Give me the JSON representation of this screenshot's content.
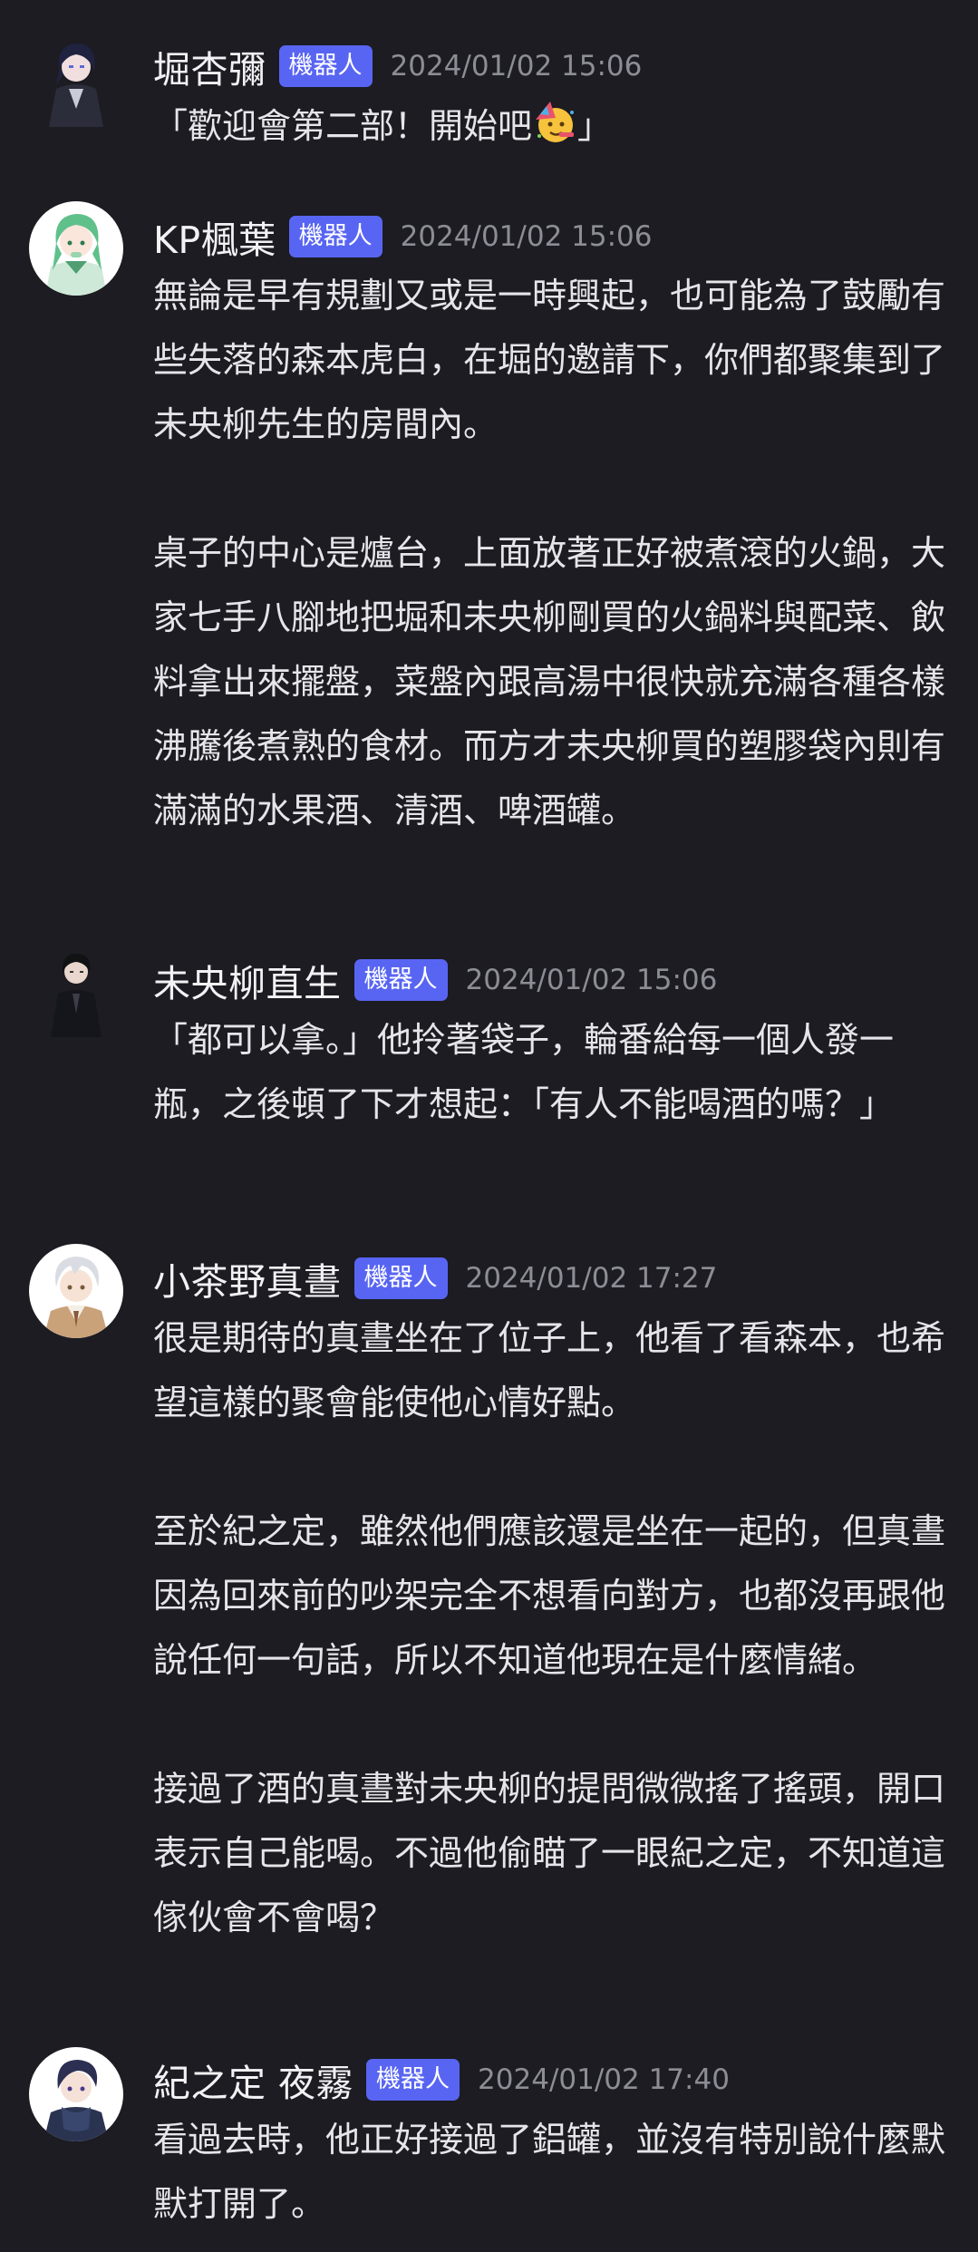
{
  "messages": [
    {
      "author": "堀杏彌",
      "badge": "機器人",
      "timestamp": "2024/01/02 15:06",
      "avatar_icon": "avatar-hori",
      "paragraphs": [
        "「歡迎會第二部！開始吧",
        "」"
      ],
      "inline_emoji": "partying-face"
    },
    {
      "author": "KP楓葉",
      "badge": "機器人",
      "timestamp": "2024/01/02 15:06",
      "avatar_icon": "avatar-kp-maple",
      "paragraphs": [
        "無論是早有規劃又或是一時興起，也可能為了鼓勵有些失落的森本虎白，在堀的邀請下，你們都聚集到了未央柳先生的房間內。",
        "桌子的中心是爐台，上面放著正好被煮滾的火鍋，大家七手八腳地把堀和未央柳剛買的火鍋料與配菜、飲料拿出來擺盤，菜盤內跟高湯中很快就充滿各種各樣沸騰後煮熟的食材。而方才未央柳買的塑膠袋內則有滿滿的水果酒、清酒、啤酒罐。"
      ]
    },
    {
      "author": "未央柳直生",
      "badge": "機器人",
      "timestamp": "2024/01/02 15:06",
      "avatar_icon": "avatar-biyouyanagi",
      "paragraphs": [
        "「都可以拿。」他拎著袋子，輪番給每一個人發一瓶，之後頓了下才想起：「有人不能喝酒的嗎？」"
      ]
    },
    {
      "author": "小茶野真晝",
      "badge": "機器人",
      "timestamp": "2024/01/02 17:27",
      "avatar_icon": "avatar-kochano",
      "paragraphs": [
        "很是期待的真晝坐在了位子上，他看了看森本，也希望這樣的聚會能使他心情好點。",
        "至於紀之定，雖然他們應該還是坐在一起的，但真晝因為回來前的吵架完全不想看向對方，也都沒再跟他說任何一句話，所以不知道他現在是什麼情緒。",
        "接過了酒的真晝對未央柳的提問微微搖了搖頭，開口表示自己能喝。不過他偷瞄了一眼紀之定，不知道這傢伙會不會喝？"
      ]
    },
    {
      "author": "紀之定 夜霧",
      "badge": "機器人",
      "timestamp": "2024/01/02 17:40",
      "avatar_icon": "avatar-kinosada",
      "paragraphs": [
        "看過去時，他正好接過了鋁罐，並沒有特別說什麼默默打開了。"
      ]
    }
  ]
}
